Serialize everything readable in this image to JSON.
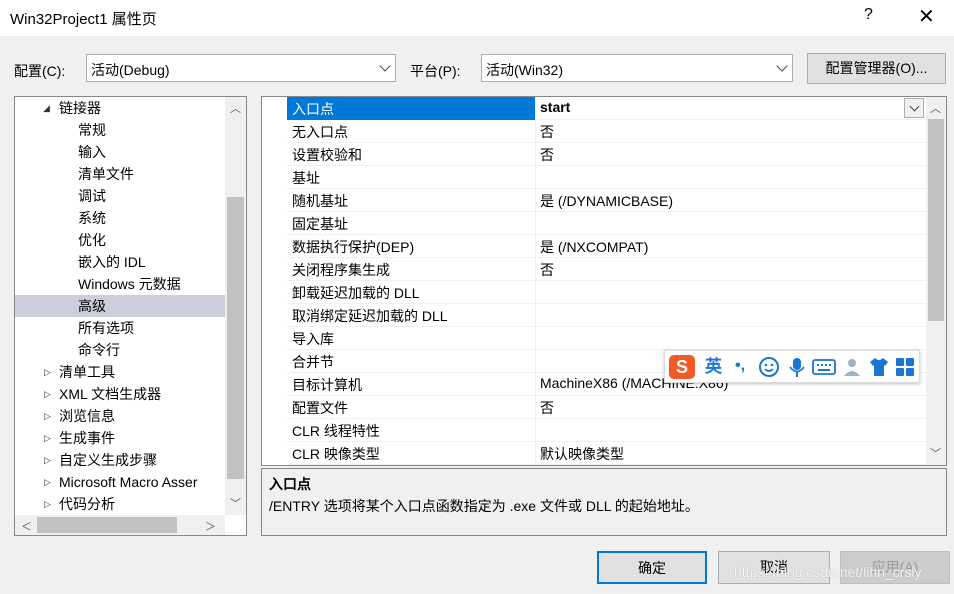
{
  "window": {
    "title": "Win32Project1 属性页",
    "help": "?",
    "close": "✕"
  },
  "config": {
    "config_label": "配置(C):",
    "config_value": "活动(Debug)",
    "platform_label": "平台(P):",
    "platform_value": "活动(Win32)",
    "manager_button": "配置管理器(O)..."
  },
  "tree": {
    "items": [
      {
        "label": "链接器",
        "expander": "◢"
      },
      {
        "label": "常规"
      },
      {
        "label": "输入"
      },
      {
        "label": "清单文件"
      },
      {
        "label": "调试"
      },
      {
        "label": "系统"
      },
      {
        "label": "优化"
      },
      {
        "label": "嵌入的 IDL"
      },
      {
        "label": "Windows 元数据"
      },
      {
        "label": "高级",
        "selected": true
      },
      {
        "label": "所有选项"
      },
      {
        "label": "命令行"
      },
      {
        "label": "清单工具",
        "expander": "▷"
      },
      {
        "label": "XML 文档生成器",
        "expander": "▷"
      },
      {
        "label": "浏览信息",
        "expander": "▷"
      },
      {
        "label": "生成事件",
        "expander": "▷"
      },
      {
        "label": "自定义生成步骤",
        "expander": "▷"
      },
      {
        "label": "Microsoft Macro Asser",
        "expander": "▷"
      },
      {
        "label": "代码分析",
        "expander": "▷"
      }
    ]
  },
  "grid": {
    "rows": [
      {
        "name": "入口点",
        "value": "start",
        "selected": true
      },
      {
        "name": "无入口点",
        "value": "否"
      },
      {
        "name": "设置校验和",
        "value": "否"
      },
      {
        "name": "基址",
        "value": ""
      },
      {
        "name": "随机基址",
        "value": "是 (/DYNAMICBASE)"
      },
      {
        "name": "固定基址",
        "value": ""
      },
      {
        "name": "数据执行保护(DEP)",
        "value": "是 (/NXCOMPAT)"
      },
      {
        "name": "关闭程序集生成",
        "value": "否"
      },
      {
        "name": "卸载延迟加载的 DLL",
        "value": ""
      },
      {
        "name": "取消绑定延迟加载的 DLL",
        "value": ""
      },
      {
        "name": "导入库",
        "value": ""
      },
      {
        "name": "合并节",
        "value": ""
      },
      {
        "name": "目标计算机",
        "value": "MachineX86 (/MACHINE:X86)"
      },
      {
        "name": "配置文件",
        "value": "否"
      },
      {
        "name": "CLR 线程特性",
        "value": ""
      },
      {
        "name": "CLR 映像类型",
        "value": "默认映像类型"
      }
    ]
  },
  "description": {
    "title": "入口点",
    "text": "/ENTRY 选项将某个入口点函数指定为 .exe 文件或 DLL 的起始地址。"
  },
  "ime": {
    "logo": "S",
    "lang": "英",
    "punct": "•,",
    "colors": {
      "logo_bg": "#f15a24",
      "icon": "#1976d2"
    }
  },
  "buttons": {
    "ok": "确定",
    "cancel": "取消",
    "apply": "应用(A)"
  },
  "watermark": "https://blog.csdn.net/lihn_crsly",
  "colors": {
    "selection": "#0078d7",
    "tree_selection": "#cccedb"
  }
}
